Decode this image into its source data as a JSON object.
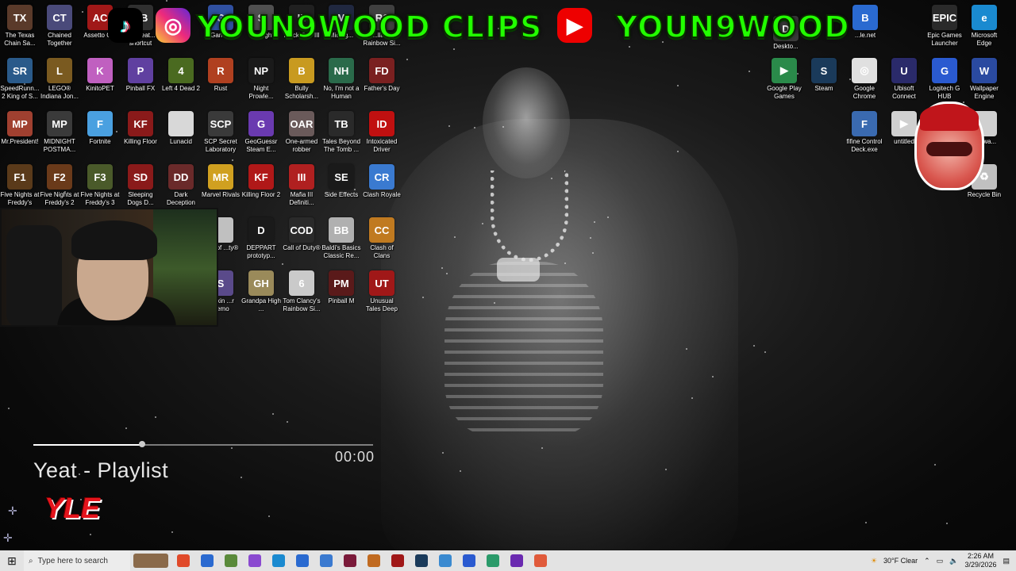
{
  "banner": {
    "left_text": "YOUN9WOOD CLIPS",
    "right_text": "YOUN9WOOD",
    "tiktok_icon": "tiktok-icon",
    "instagram_icon": "instagram-icon",
    "youtube_icon": "youtube-icon",
    "text_color": "#22ff00"
  },
  "desktop_icons": [
    {
      "label": "The Texas Chain Sa...",
      "color": "#5a3a2a",
      "glyph": "TX"
    },
    {
      "label": "Chained Together",
      "color": "#4a4a7a",
      "glyph": "CT"
    },
    {
      "label": "Assetto C...",
      "color": "#a01818",
      "glyph": "AC"
    },
    {
      "label": "Bet Beat... shortcut",
      "color": "#303030",
      "glyph": "BB"
    },
    {
      "label": "Games",
      "color": "#3050a0",
      "glyph": "G"
    },
    {
      "label": "Spotlight",
      "color": "#505050",
      "glyph": "S"
    },
    {
      "label": "Black Ops III",
      "color": "#202020",
      "glyph": "III"
    },
    {
      "label": "Midnig...",
      "color": "#202840",
      "glyph": "M"
    },
    {
      "label": "...lland Rainbow Si...",
      "color": "#404040",
      "glyph": "R6"
    },
    {
      "label": "SpeedRunn... 2 King of S...",
      "color": "#2a5a8a",
      "glyph": "SR"
    },
    {
      "label": "LEGO® Indiana Jon...",
      "color": "#7a5a20",
      "glyph": "L"
    },
    {
      "label": "KinitoPET",
      "color": "#c060c0",
      "glyph": "K"
    },
    {
      "label": "Pinball FX",
      "color": "#6040a0",
      "glyph": "P"
    },
    {
      "label": "Left 4 Dead 2",
      "color": "#4a6a20",
      "glyph": "4"
    },
    {
      "label": "Rust",
      "color": "#b04020",
      "glyph": "R"
    },
    {
      "label": "Night Prowle...",
      "color": "#1a1a1a",
      "glyph": "NP"
    },
    {
      "label": "Bully Scholarsh...",
      "color": "#c89a20",
      "glyph": "B"
    },
    {
      "label": "No, I'm not a Human",
      "color": "#2a6a4a",
      "glyph": "NH"
    },
    {
      "label": "Father's Day",
      "color": "#7a2020",
      "glyph": "FD"
    },
    {
      "label": "Mr.President!",
      "color": "#a04030",
      "glyph": "MP"
    },
    {
      "label": "MIDNIGHT POSTMA...",
      "color": "#3a3a3a",
      "glyph": "MP"
    },
    {
      "label": "Fortnite",
      "color": "#4aa0e0",
      "glyph": "F"
    },
    {
      "label": "Killing Floor",
      "color": "#8a1a1a",
      "glyph": "KF"
    },
    {
      "label": "Lunacid",
      "color": "#d8d8d8",
      "glyph": ""
    },
    {
      "label": "SCP Secret Laboratory",
      "color": "#3a3a3a",
      "glyph": "SCP"
    },
    {
      "label": "GeoGuessr Steam E...",
      "color": "#6a3ab0",
      "glyph": "G"
    },
    {
      "label": "One-armed robber",
      "color": "#6a5a5a",
      "glyph": "OAR"
    },
    {
      "label": "Tales Beyond The Tomb ...",
      "color": "#2a2a2a",
      "glyph": "TB"
    },
    {
      "label": "Intoxicated Driver",
      "color": "#c01010",
      "glyph": "ID"
    },
    {
      "label": "Five Nights at Freddy's",
      "color": "#5a3a1a",
      "glyph": "F1"
    },
    {
      "label": "Five Nights at Freddy's 2",
      "color": "#6a3a1a",
      "glyph": "F2"
    },
    {
      "label": "Five Nights at Freddy's 3",
      "color": "#4a5a2a",
      "glyph": "F3"
    },
    {
      "label": "Sleeping Dogs D...",
      "color": "#8a1a1a",
      "glyph": "SD"
    },
    {
      "label": "Dark Deception",
      "color": "#6a2a2a",
      "glyph": "DD"
    },
    {
      "label": "Marvel Rivals",
      "color": "#d0a020",
      "glyph": "MR"
    },
    {
      "label": "Killing Floor 2",
      "color": "#b01818",
      "glyph": "KF"
    },
    {
      "label": "Mafia III Definiti...",
      "color": "#b02020",
      "glyph": "III"
    },
    {
      "label": "Side Effects",
      "color": "#1a1a1a",
      "glyph": "SE"
    },
    {
      "label": "Clash Royale",
      "color": "#3a7ad0",
      "glyph": "CR"
    },
    {
      "label": "...all of ...ty®",
      "color": "#c0c0c0",
      "glyph": ""
    },
    {
      "label": "DEPPART prototyp...",
      "color": "#1a1a1a",
      "glyph": "D"
    },
    {
      "label": "Call of Duty®",
      "color": "#2a2a2a",
      "glyph": "COD"
    },
    {
      "label": "Baldi's Basics Classic Re...",
      "color": "#b0b0b0",
      "glyph": "BB"
    },
    {
      "label": "Clash of Clans",
      "color": "#c07a20",
      "glyph": "CC"
    },
    {
      "label": "...Skin ...r Demo",
      "color": "#5a4a8a",
      "glyph": "S"
    },
    {
      "label": "Grandpa High ...",
      "color": "#9a8a5a",
      "glyph": "GH"
    },
    {
      "label": "Tom Clancy's Rainbow Si...",
      "color": "#cacaca",
      "glyph": "6"
    },
    {
      "label": "Pinball M",
      "color": "#5a1a1a",
      "glyph": "PM"
    },
    {
      "label": "Unusual Tales Deep Below",
      "color": "#a01818",
      "glyph": "UT"
    },
    {
      "label": "Epic Games Launcher",
      "color": "#2a2a2a",
      "glyph": "EPIC"
    },
    {
      "label": "Microsoft Edge",
      "color": "#1a8ad0",
      "glyph": "e"
    },
    {
      "label": "...le.net",
      "color": "#2a6ad0",
      "glyph": "B"
    },
    {
      "label": "Deskto...",
      "color": "#3a3a3a",
      "glyph": "D"
    },
    {
      "label": "Google Play Games",
      "color": "#2a8a4a",
      "glyph": "▶"
    },
    {
      "label": "Steam",
      "color": "#1a3a5a",
      "glyph": "S"
    },
    {
      "label": "Google Chrome",
      "color": "#e0e0e0",
      "glyph": "◎"
    },
    {
      "label": "Ubisoft Connect",
      "color": "#2a2a6a",
      "glyph": "U"
    },
    {
      "label": "Logitech G HUB",
      "color": "#2a5ad0",
      "glyph": "G"
    },
    {
      "label": "Wallpaper Engine",
      "color": "#2a4aa0",
      "glyph": "W"
    },
    {
      "label": "fifine Control Deck.exe",
      "color": "#3a6ab0",
      "glyph": "F"
    },
    {
      "label": "untitled",
      "color": "#d0d0d0",
      "glyph": "▶"
    },
    {
      "label": "...d.wa...",
      "color": "#d0d0d0",
      "glyph": ""
    },
    {
      "label": "Recycle Bin",
      "color": "#c0c0c0",
      "glyph": "♻"
    }
  ],
  "player": {
    "song_title": "Yeat - Playlist",
    "time": "00:00",
    "progress": 0.32,
    "logo_text": "YLE"
  },
  "taskbar": {
    "search_placeholder": "Type here to search",
    "weather": "30°F  Clear",
    "time": "2:26 AM",
    "date": "3/29/2026",
    "apps": [
      {
        "name": "taskbar-wallpaper-thumb",
        "color": "#8a6a4a"
      },
      {
        "name": "taskbar-chrome",
        "color": "#e04a2a"
      },
      {
        "name": "taskbar-firefox",
        "color": "#2a6ad0"
      },
      {
        "name": "taskbar-minecraft",
        "color": "#5a8a3a"
      },
      {
        "name": "taskbar-copilot",
        "color": "#8a4ad0"
      },
      {
        "name": "taskbar-edge",
        "color": "#1a8ad0"
      },
      {
        "name": "taskbar-store",
        "color": "#2a6ad0"
      },
      {
        "name": "taskbar-app-7",
        "color": "#3a7ad0"
      },
      {
        "name": "taskbar-app-8",
        "color": "#7a1a3a"
      },
      {
        "name": "taskbar-app-9",
        "color": "#c06a20"
      },
      {
        "name": "taskbar-app-10",
        "color": "#a01818"
      },
      {
        "name": "taskbar-steam",
        "color": "#1a3a5a"
      },
      {
        "name": "taskbar-app-12",
        "color": "#3a8ad0"
      },
      {
        "name": "taskbar-app-13",
        "color": "#2a5ad0"
      },
      {
        "name": "taskbar-app-14",
        "color": "#2a9a6a"
      },
      {
        "name": "taskbar-app-15",
        "color": "#6a2ab0"
      },
      {
        "name": "taskbar-app-16",
        "color": "#e05a3a"
      }
    ]
  }
}
